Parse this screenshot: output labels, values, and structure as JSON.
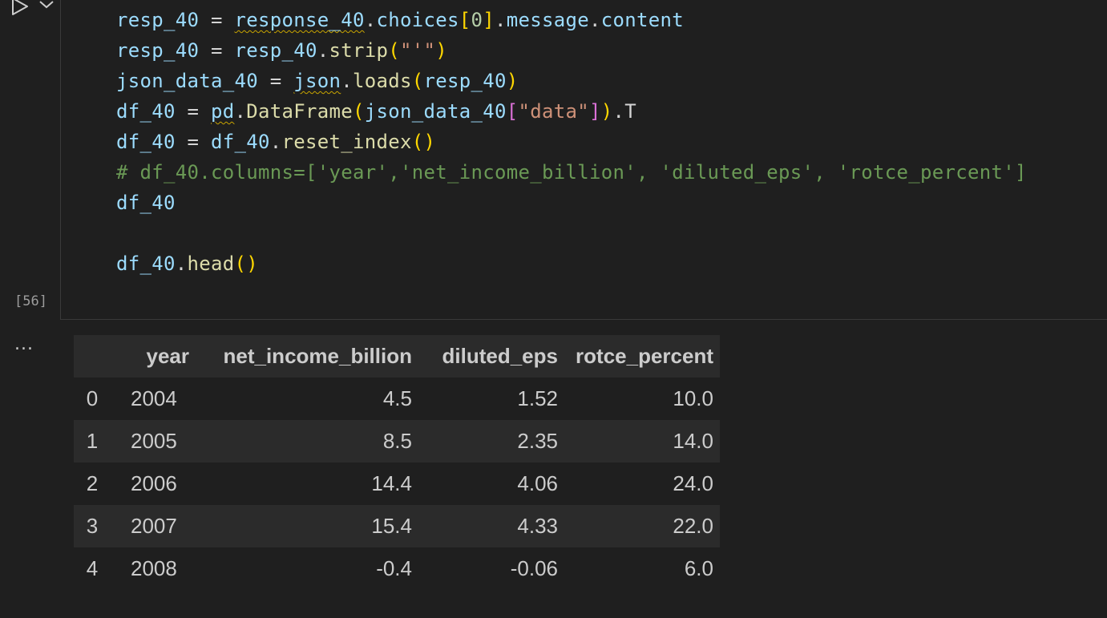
{
  "cell": {
    "execution_count": "[56]",
    "code_lines": [
      "resp_40 = response_40.choices[0].message.content",
      "resp_40 = resp_40.strip(\"'\")",
      "json_data_40 = json.loads(resp_40)",
      "df_40 = pd.DataFrame(json_data_40[\"data\"]).T",
      "df_40 = df_40.reset_index()",
      "# df_40.columns=['year','net_income_billion', 'diluted_eps', 'rotce_percent']",
      "df_40",
      "",
      "df_40.head()"
    ]
  },
  "output": {
    "more_label": "...",
    "table": {
      "columns": [
        "",
        "year",
        "net_income_billion",
        "diluted_eps",
        "rotce_percent"
      ],
      "rows": [
        [
          "0",
          "2004",
          "4.5",
          "1.52",
          "10.0"
        ],
        [
          "1",
          "2005",
          "8.5",
          "2.35",
          "14.0"
        ],
        [
          "2",
          "2006",
          "14.4",
          "4.06",
          "24.0"
        ],
        [
          "3",
          "2007",
          "15.4",
          "4.33",
          "22.0"
        ],
        [
          "4",
          "2008",
          "-0.4",
          "-0.06",
          "6.0"
        ]
      ]
    }
  },
  "colors": {
    "background": "#1f1f1f",
    "table_stripe": "#2b2b2b",
    "variable": "#9cdcfe",
    "function": "#dcdcaa",
    "string": "#ce9178",
    "number": "#b5cea8",
    "comment": "#6a9955",
    "bracket": "#ffd700"
  },
  "icons": {
    "run": "play-icon",
    "run_options": "chevron-down-icon",
    "output_actions": "more-icon"
  }
}
